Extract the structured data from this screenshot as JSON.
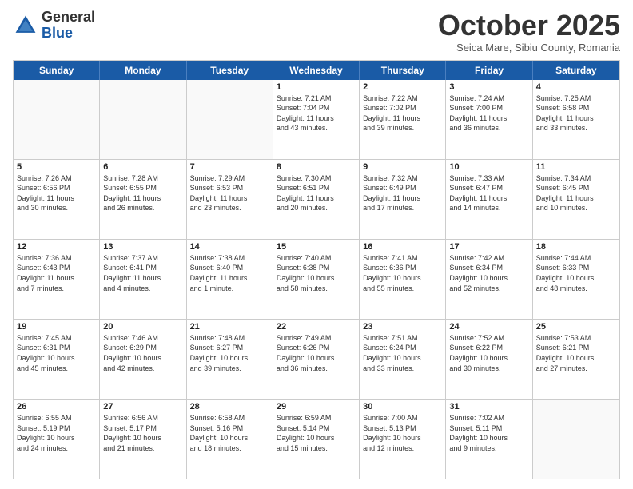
{
  "logo": {
    "general": "General",
    "blue": "Blue"
  },
  "title": "October 2025",
  "subtitle": "Seica Mare, Sibiu County, Romania",
  "header_days": [
    "Sunday",
    "Monday",
    "Tuesday",
    "Wednesday",
    "Thursday",
    "Friday",
    "Saturday"
  ],
  "rows": [
    [
      {
        "day": "",
        "lines": [],
        "empty": true
      },
      {
        "day": "",
        "lines": [],
        "empty": true
      },
      {
        "day": "",
        "lines": [],
        "empty": true
      },
      {
        "day": "1",
        "lines": [
          "Sunrise: 7:21 AM",
          "Sunset: 7:04 PM",
          "Daylight: 11 hours",
          "and 43 minutes."
        ]
      },
      {
        "day": "2",
        "lines": [
          "Sunrise: 7:22 AM",
          "Sunset: 7:02 PM",
          "Daylight: 11 hours",
          "and 39 minutes."
        ]
      },
      {
        "day": "3",
        "lines": [
          "Sunrise: 7:24 AM",
          "Sunset: 7:00 PM",
          "Daylight: 11 hours",
          "and 36 minutes."
        ]
      },
      {
        "day": "4",
        "lines": [
          "Sunrise: 7:25 AM",
          "Sunset: 6:58 PM",
          "Daylight: 11 hours",
          "and 33 minutes."
        ]
      }
    ],
    [
      {
        "day": "5",
        "lines": [
          "Sunrise: 7:26 AM",
          "Sunset: 6:56 PM",
          "Daylight: 11 hours",
          "and 30 minutes."
        ]
      },
      {
        "day": "6",
        "lines": [
          "Sunrise: 7:28 AM",
          "Sunset: 6:55 PM",
          "Daylight: 11 hours",
          "and 26 minutes."
        ]
      },
      {
        "day": "7",
        "lines": [
          "Sunrise: 7:29 AM",
          "Sunset: 6:53 PM",
          "Daylight: 11 hours",
          "and 23 minutes."
        ]
      },
      {
        "day": "8",
        "lines": [
          "Sunrise: 7:30 AM",
          "Sunset: 6:51 PM",
          "Daylight: 11 hours",
          "and 20 minutes."
        ]
      },
      {
        "day": "9",
        "lines": [
          "Sunrise: 7:32 AM",
          "Sunset: 6:49 PM",
          "Daylight: 11 hours",
          "and 17 minutes."
        ]
      },
      {
        "day": "10",
        "lines": [
          "Sunrise: 7:33 AM",
          "Sunset: 6:47 PM",
          "Daylight: 11 hours",
          "and 14 minutes."
        ]
      },
      {
        "day": "11",
        "lines": [
          "Sunrise: 7:34 AM",
          "Sunset: 6:45 PM",
          "Daylight: 11 hours",
          "and 10 minutes."
        ]
      }
    ],
    [
      {
        "day": "12",
        "lines": [
          "Sunrise: 7:36 AM",
          "Sunset: 6:43 PM",
          "Daylight: 11 hours",
          "and 7 minutes."
        ]
      },
      {
        "day": "13",
        "lines": [
          "Sunrise: 7:37 AM",
          "Sunset: 6:41 PM",
          "Daylight: 11 hours",
          "and 4 minutes."
        ]
      },
      {
        "day": "14",
        "lines": [
          "Sunrise: 7:38 AM",
          "Sunset: 6:40 PM",
          "Daylight: 11 hours",
          "and 1 minute."
        ]
      },
      {
        "day": "15",
        "lines": [
          "Sunrise: 7:40 AM",
          "Sunset: 6:38 PM",
          "Daylight: 10 hours",
          "and 58 minutes."
        ]
      },
      {
        "day": "16",
        "lines": [
          "Sunrise: 7:41 AM",
          "Sunset: 6:36 PM",
          "Daylight: 10 hours",
          "and 55 minutes."
        ]
      },
      {
        "day": "17",
        "lines": [
          "Sunrise: 7:42 AM",
          "Sunset: 6:34 PM",
          "Daylight: 10 hours",
          "and 52 minutes."
        ]
      },
      {
        "day": "18",
        "lines": [
          "Sunrise: 7:44 AM",
          "Sunset: 6:33 PM",
          "Daylight: 10 hours",
          "and 48 minutes."
        ]
      }
    ],
    [
      {
        "day": "19",
        "lines": [
          "Sunrise: 7:45 AM",
          "Sunset: 6:31 PM",
          "Daylight: 10 hours",
          "and 45 minutes."
        ]
      },
      {
        "day": "20",
        "lines": [
          "Sunrise: 7:46 AM",
          "Sunset: 6:29 PM",
          "Daylight: 10 hours",
          "and 42 minutes."
        ]
      },
      {
        "day": "21",
        "lines": [
          "Sunrise: 7:48 AM",
          "Sunset: 6:27 PM",
          "Daylight: 10 hours",
          "and 39 minutes."
        ]
      },
      {
        "day": "22",
        "lines": [
          "Sunrise: 7:49 AM",
          "Sunset: 6:26 PM",
          "Daylight: 10 hours",
          "and 36 minutes."
        ]
      },
      {
        "day": "23",
        "lines": [
          "Sunrise: 7:51 AM",
          "Sunset: 6:24 PM",
          "Daylight: 10 hours",
          "and 33 minutes."
        ]
      },
      {
        "day": "24",
        "lines": [
          "Sunrise: 7:52 AM",
          "Sunset: 6:22 PM",
          "Daylight: 10 hours",
          "and 30 minutes."
        ]
      },
      {
        "day": "25",
        "lines": [
          "Sunrise: 7:53 AM",
          "Sunset: 6:21 PM",
          "Daylight: 10 hours",
          "and 27 minutes."
        ]
      }
    ],
    [
      {
        "day": "26",
        "lines": [
          "Sunrise: 6:55 AM",
          "Sunset: 5:19 PM",
          "Daylight: 10 hours",
          "and 24 minutes."
        ]
      },
      {
        "day": "27",
        "lines": [
          "Sunrise: 6:56 AM",
          "Sunset: 5:17 PM",
          "Daylight: 10 hours",
          "and 21 minutes."
        ]
      },
      {
        "day": "28",
        "lines": [
          "Sunrise: 6:58 AM",
          "Sunset: 5:16 PM",
          "Daylight: 10 hours",
          "and 18 minutes."
        ]
      },
      {
        "day": "29",
        "lines": [
          "Sunrise: 6:59 AM",
          "Sunset: 5:14 PM",
          "Daylight: 10 hours",
          "and 15 minutes."
        ]
      },
      {
        "day": "30",
        "lines": [
          "Sunrise: 7:00 AM",
          "Sunset: 5:13 PM",
          "Daylight: 10 hours",
          "and 12 minutes."
        ]
      },
      {
        "day": "31",
        "lines": [
          "Sunrise: 7:02 AM",
          "Sunset: 5:11 PM",
          "Daylight: 10 hours",
          "and 9 minutes."
        ]
      },
      {
        "day": "",
        "lines": [],
        "empty": true
      }
    ]
  ]
}
